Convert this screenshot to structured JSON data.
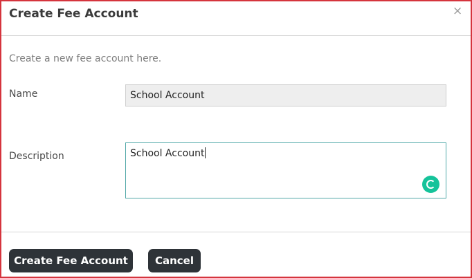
{
  "dialog": {
    "title": "Create Fee Account",
    "close_symbol": "×",
    "intro": "Create a new fee account here."
  },
  "form": {
    "name_label": "Name",
    "name_value": "School Account",
    "description_label": "Description",
    "description_value": "School Account"
  },
  "buttons": {
    "create_label": "Create Fee Account",
    "cancel_label": "Cancel"
  },
  "colors": {
    "frame_border": "#d5343d",
    "button_bg": "#2e3338",
    "focus_border": "#4fa7a7",
    "grammarly": "#15c39a"
  },
  "icons": {
    "close": "close-icon",
    "grammarly": "grammarly-icon"
  }
}
